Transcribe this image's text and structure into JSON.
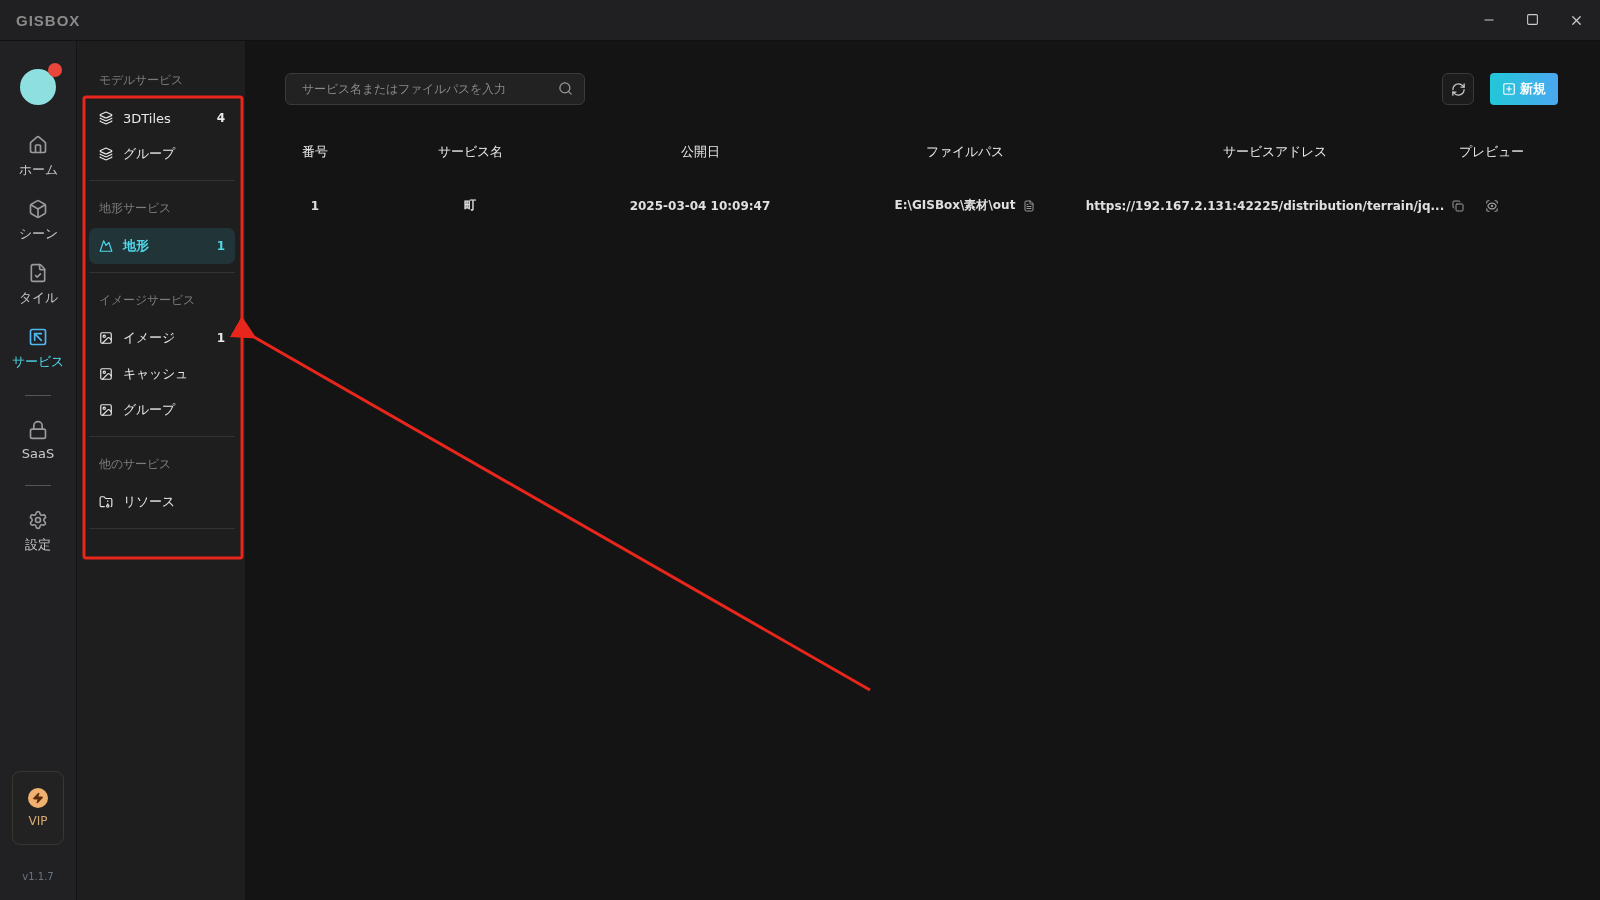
{
  "window": {
    "title": "GISBOX"
  },
  "rail": {
    "items": [
      {
        "kind": "home",
        "label": "ホーム",
        "selected": false
      },
      {
        "kind": "scene",
        "label": "シーン",
        "selected": false
      },
      {
        "kind": "tile",
        "label": "タイル",
        "selected": false
      },
      {
        "kind": "service",
        "label": "サービス",
        "selected": true
      },
      {
        "kind": "saas",
        "label": "SaaS",
        "selected": false
      },
      {
        "kind": "settings",
        "label": "設定",
        "selected": false
      }
    ],
    "vip": "VIP",
    "version": "v1.1.7"
  },
  "subnav": {
    "sections": [
      {
        "kind": "model",
        "title": "モデルサービス",
        "items": [
          {
            "label": "3DTiles",
            "count": "4",
            "selected": false
          },
          {
            "label": "グループ",
            "selected": false
          }
        ]
      },
      {
        "kind": "terrain",
        "title": "地形サービス",
        "items": [
          {
            "label": "地形",
            "count": "1",
            "selected": true
          }
        ]
      },
      {
        "kind": "image",
        "title": "イメージサービス",
        "items": [
          {
            "label": "イメージ",
            "count": "1",
            "selected": false
          },
          {
            "label": "キャッシュ",
            "selected": false
          },
          {
            "label": "グループ",
            "selected": false
          }
        ]
      },
      {
        "kind": "other",
        "title": "他のサービス",
        "items": [
          {
            "label": "リソース",
            "selected": false
          }
        ]
      }
    ]
  },
  "search": {
    "placeholder": "サービス名またはファイルパスを入力"
  },
  "new_button": "新規",
  "table": {
    "columns": [
      "番号",
      "サービス名",
      "公開日",
      "ファイルパス",
      "サービスアドレス",
      "プレビュー"
    ],
    "rows": [
      {
        "number": "1",
        "name": "町",
        "date": "2025-03-04 10:09:47",
        "path": "E:\\GISBox\\素材\\out",
        "address": "https://192.167.2.131:42225/distribution/terrain/jq..."
      }
    ]
  }
}
